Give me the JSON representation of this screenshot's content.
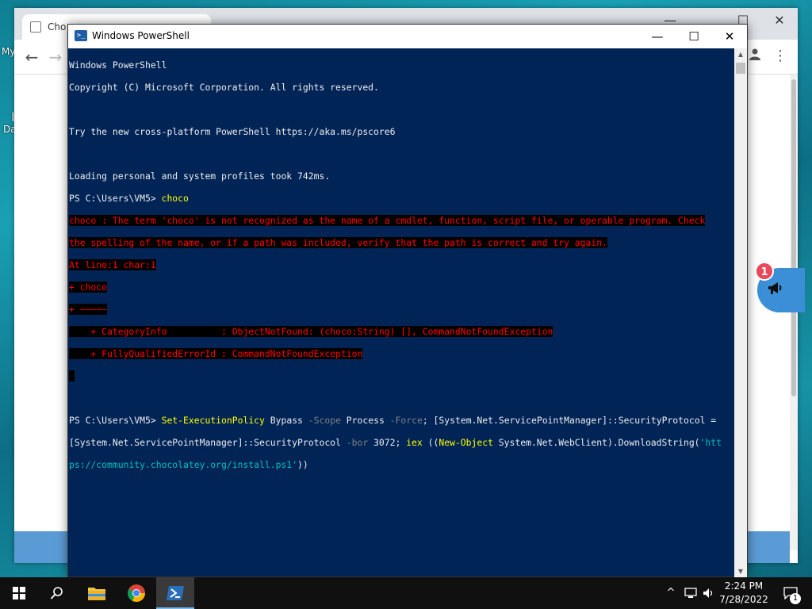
{
  "desktop": {
    "label_1": "My",
    "label_2": "I",
    "label_3": "Da"
  },
  "browser": {
    "tab_title": "Cho",
    "minimize": "—",
    "maximize": "☐",
    "close": "✕",
    "back": "←",
    "forward": "→",
    "more": "⋮",
    "profile_icon": "person-icon"
  },
  "announcement": {
    "badge_count": "1",
    "icon": "megaphone-icon"
  },
  "powershell": {
    "title": "Windows PowerShell",
    "minimize": "—",
    "maximize": "☐",
    "close": "✕",
    "scroll_up": "▲",
    "scroll_down": "▼",
    "console": {
      "l1": "Windows PowerShell",
      "l2": "Copyright (C) Microsoft Corporation. All rights reserved.",
      "l3": "",
      "l4": "Try the new cross-platform PowerShell https://aka.ms/pscore6",
      "l5": "",
      "l6": "Loading personal and system profiles took 742ms.",
      "l7_prompt": "PS C:\\Users\\VM5> ",
      "l7_cmd": "choco",
      "l8": "choco : The term 'choco' is not recognized as the name of a cmdlet, function, script file, or operable program. Check",
      "l9": "the spelling of the name, or if a path was included, verify that the path is correct and try again.",
      "l10": "At line:1 char:1",
      "l11": "+ choco",
      "l12": "+ ~~~~~",
      "l13": "    + CategoryInfo          : ObjectNotFound: (choco:String) [], CommandNotFoundException",
      "l14": "    + FullyQualifiedErrorId : CommandNotFoundException",
      "l15": " ",
      "l16": "",
      "l17_prompt": "PS C:\\Users\\VM5> ",
      "l17_a": "Set-ExecutionPolicy",
      "l17_b": " Bypass ",
      "l17_c": "-Scope",
      "l17_d": " Process ",
      "l17_e": "-Force",
      "l17_f": "; [System.Net.ServicePointManager]::SecurityProtocol =",
      "l18_a": "[System.Net.ServicePointManager]::SecurityProtocol ",
      "l18_b": "-bor",
      "l18_c": " 3072; ",
      "l18_d": "iex",
      "l18_e": " ((",
      "l18_f": "New-Object",
      "l18_g": " System.Net.WebClient).DownloadString(",
      "l18_h": "'htt",
      "l19_a": "ps://community.chocolatey.org/install.ps1'",
      "l19_b": "))"
    }
  },
  "taskbar": {
    "search_icon": "search-icon",
    "file_explorer_icon": "folder-icon",
    "chrome_icon": "chrome-icon",
    "powershell_icon": "powershell-icon",
    "tray_chevron": "^",
    "clock_time": "2:24 PM",
    "clock_date": "7/28/2022",
    "notification_count": "1"
  },
  "colors": {
    "console_bg": "#012456",
    "console_fg": "#eeedf0",
    "error_fg": "#ff0000",
    "command_yellow": "#ffff00",
    "param_gray": "#808080",
    "string_cyan": "#00bfbf",
    "taskbar_bg": "#101010"
  }
}
